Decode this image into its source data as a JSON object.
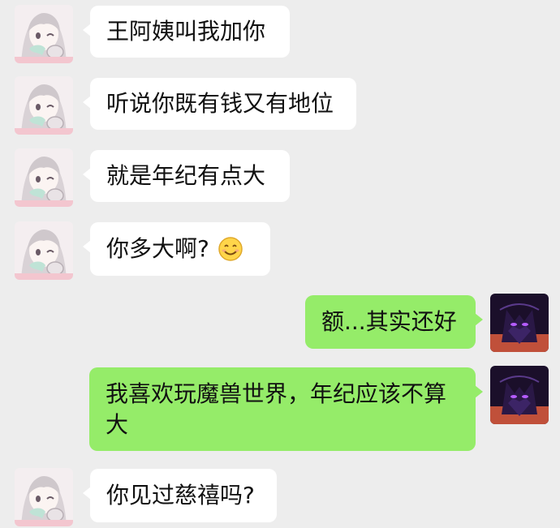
{
  "messages": [
    {
      "side": "in",
      "text": "王阿姨叫我加你",
      "avatar": "anime-girl-avatar-icon"
    },
    {
      "side": "in",
      "text": "听说你既有钱又有地位",
      "avatar": "anime-girl-avatar-icon"
    },
    {
      "side": "in",
      "text": "就是年纪有点大",
      "avatar": "anime-girl-avatar-icon"
    },
    {
      "side": "in",
      "text": "你多大啊?",
      "emoji": "smiling-face-emoji-icon",
      "avatar": "anime-girl-avatar-icon"
    },
    {
      "side": "out",
      "text": "额...其实还好",
      "avatar": "dark-wolf-avatar-icon"
    },
    {
      "side": "out",
      "text": "我喜欢玩魔兽世界，年纪应该不算大",
      "avatar": "dark-wolf-avatar-icon"
    },
    {
      "side": "in",
      "text": "你见过慈禧吗?",
      "avatar": "anime-girl-avatar-icon"
    }
  ],
  "colors": {
    "background": "#ededed",
    "incoming_bubble": "#ffffff",
    "outgoing_bubble": "#95ec69"
  }
}
